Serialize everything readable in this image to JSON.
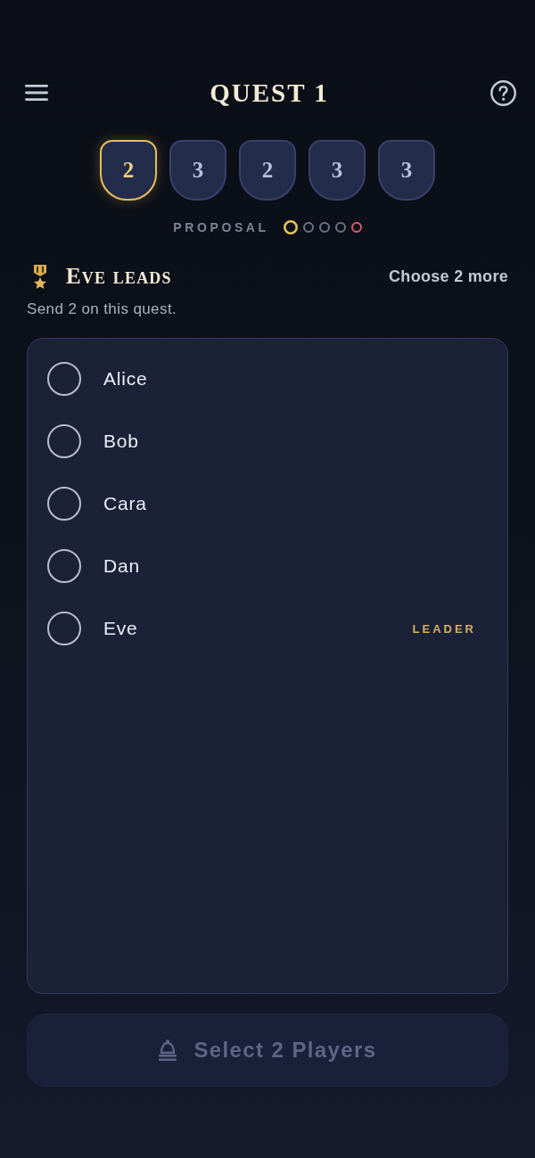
{
  "header": {
    "title": "QUEST 1"
  },
  "quests": [
    {
      "team_size": "2",
      "selected": true
    },
    {
      "team_size": "3",
      "selected": false
    },
    {
      "team_size": "2",
      "selected": false
    },
    {
      "team_size": "3",
      "selected": false
    },
    {
      "team_size": "3",
      "selected": false
    }
  ],
  "proposal": {
    "label": "PROPOSAL",
    "dots": [
      {
        "selected": true,
        "color": "#e5bf5e"
      },
      {
        "selected": false,
        "color": "#6d7488"
      },
      {
        "selected": false,
        "color": "#6d7488"
      },
      {
        "selected": false,
        "color": "#6d7488"
      },
      {
        "selected": false,
        "color": "#d9606c"
      }
    ]
  },
  "leader": {
    "heading": "Eve leads",
    "remaining": "Choose 2 more",
    "instruction": "Send 2 on this quest."
  },
  "players": [
    {
      "name": "Alice",
      "selected": false
    },
    {
      "name": "Bob",
      "selected": false
    },
    {
      "name": "Cara",
      "selected": false
    },
    {
      "name": "Dan",
      "selected": false
    },
    {
      "name": "Eve",
      "selected": false,
      "badge": "LEADER"
    }
  ],
  "action_button": {
    "label": "Select 2 Players",
    "disabled": true
  }
}
